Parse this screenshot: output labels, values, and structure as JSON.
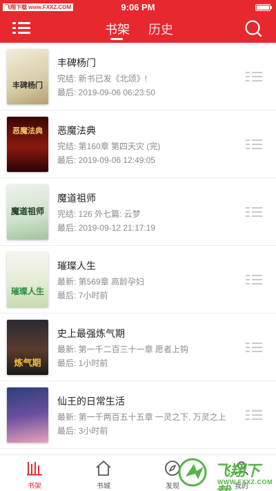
{
  "status_bar": {
    "carrier": "飞翔下载 www.FXXZ.COM",
    "time": "9:06 PM"
  },
  "header": {
    "tabs": [
      {
        "label": "书架",
        "active": true
      },
      {
        "label": "历史",
        "active": false
      }
    ],
    "menu_icon": "menu-icon",
    "search_icon": "search-icon"
  },
  "books": [
    {
      "title": "丰碑杨门",
      "status": "完结: 新书已发《北颂》!",
      "last": "最后: 2019-09-06 06:23:50",
      "cover_text": "丰碑杨门"
    },
    {
      "title": "恶魔法典",
      "status": "完结: 第160章 第四天灾 (完)",
      "last": "最后: 2019-09-06 12:49:05",
      "cover_text": "恶魔法典"
    },
    {
      "title": "魔道祖师",
      "status": "完结: 126 外七篇: 云梦",
      "last": "最后: 2019-09-12 21:17:19",
      "cover_text": "魔道祖师"
    },
    {
      "title": "璀璨人生",
      "status": "最新: 第569章 高龄孕妇",
      "last": "最后: 7小时前",
      "cover_text": "璀璨人生"
    },
    {
      "title": "史上最强炼气期",
      "status": "最新: 第一千二百三十一章 愿者上钩",
      "last": "最后: 1小时前",
      "cover_text": "炼气期"
    },
    {
      "title": "仙王的日常生活",
      "status": "最新: 第一千两百五十五章 一灵之下, 万灵之上",
      "last": "最后: 3小时前",
      "cover_text": ""
    }
  ],
  "bottom_nav": [
    {
      "label": "书架",
      "icon": "bookshelf-icon",
      "active": true
    },
    {
      "label": "书城",
      "icon": "bookstore-icon",
      "active": false
    },
    {
      "label": "发现",
      "icon": "compass-icon",
      "active": false
    },
    {
      "label": "我的",
      "icon": "profile-icon",
      "active": false
    }
  ],
  "watermark": {
    "word": "飞翔下载",
    "url": "WWW.FXXZ.COM"
  },
  "colors": {
    "accent": "#e8282f",
    "watermark": "#57b24a"
  }
}
